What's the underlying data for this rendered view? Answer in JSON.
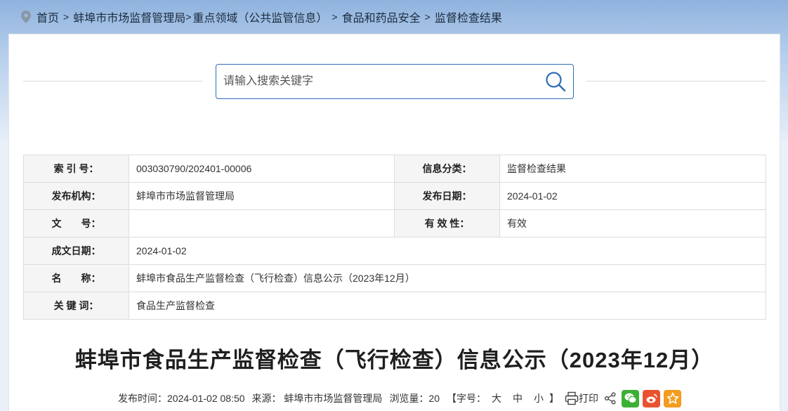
{
  "breadcrumb": {
    "items": [
      "首页",
      "蚌埠市市场监督管理局",
      "重点领域（公共监管信息）",
      "食品和药品安全",
      "监督检查结果"
    ],
    "separator": ">"
  },
  "search": {
    "placeholder": "请输入搜索关键字"
  },
  "meta": {
    "index_label": "索 引 号：",
    "index_value": "003030790/202401-00006",
    "category_label": "信息分类：",
    "category_value": "监督检查结果",
    "publisher_label": "发布机构：",
    "publisher_value": "蚌埠市市场监督管理局",
    "pubdate_label": "发布日期：",
    "pubdate_value": "2024-01-02",
    "docno_label": "文　　号：",
    "docno_value": "",
    "validity_label": "有 效 性：",
    "validity_value": "有效",
    "writedate_label": "成文日期：",
    "writedate_value": "2024-01-02",
    "name_label": "名　　称：",
    "name_value": "蚌埠市食品生产监督检查（飞行检查）信息公示（2023年12月）",
    "keywords_label": "关 键 词：",
    "keywords_value": "食品生产监督检查"
  },
  "article": {
    "title": "蚌埠市食品生产监督检查（飞行检查）信息公示（2023年12月）",
    "publish_time": "发布时间：2024-01-02 08:50",
    "source": "来源： 蚌埠市市场监督管理局",
    "views": "浏览量：20",
    "font_size_open": "【字号：",
    "font_large": "大",
    "font_medium": "中",
    "font_small": "小",
    "font_size_close": "】",
    "print_label": "打印"
  },
  "colors": {
    "accent": "#2f6db5",
    "wechat": "#3cb034",
    "weibo": "#e8532f",
    "favorite": "#f39c1f"
  },
  "icons": [
    "location-icon",
    "search-icon",
    "print-icon",
    "share-icon",
    "wechat-icon",
    "weibo-icon",
    "star-icon"
  ]
}
